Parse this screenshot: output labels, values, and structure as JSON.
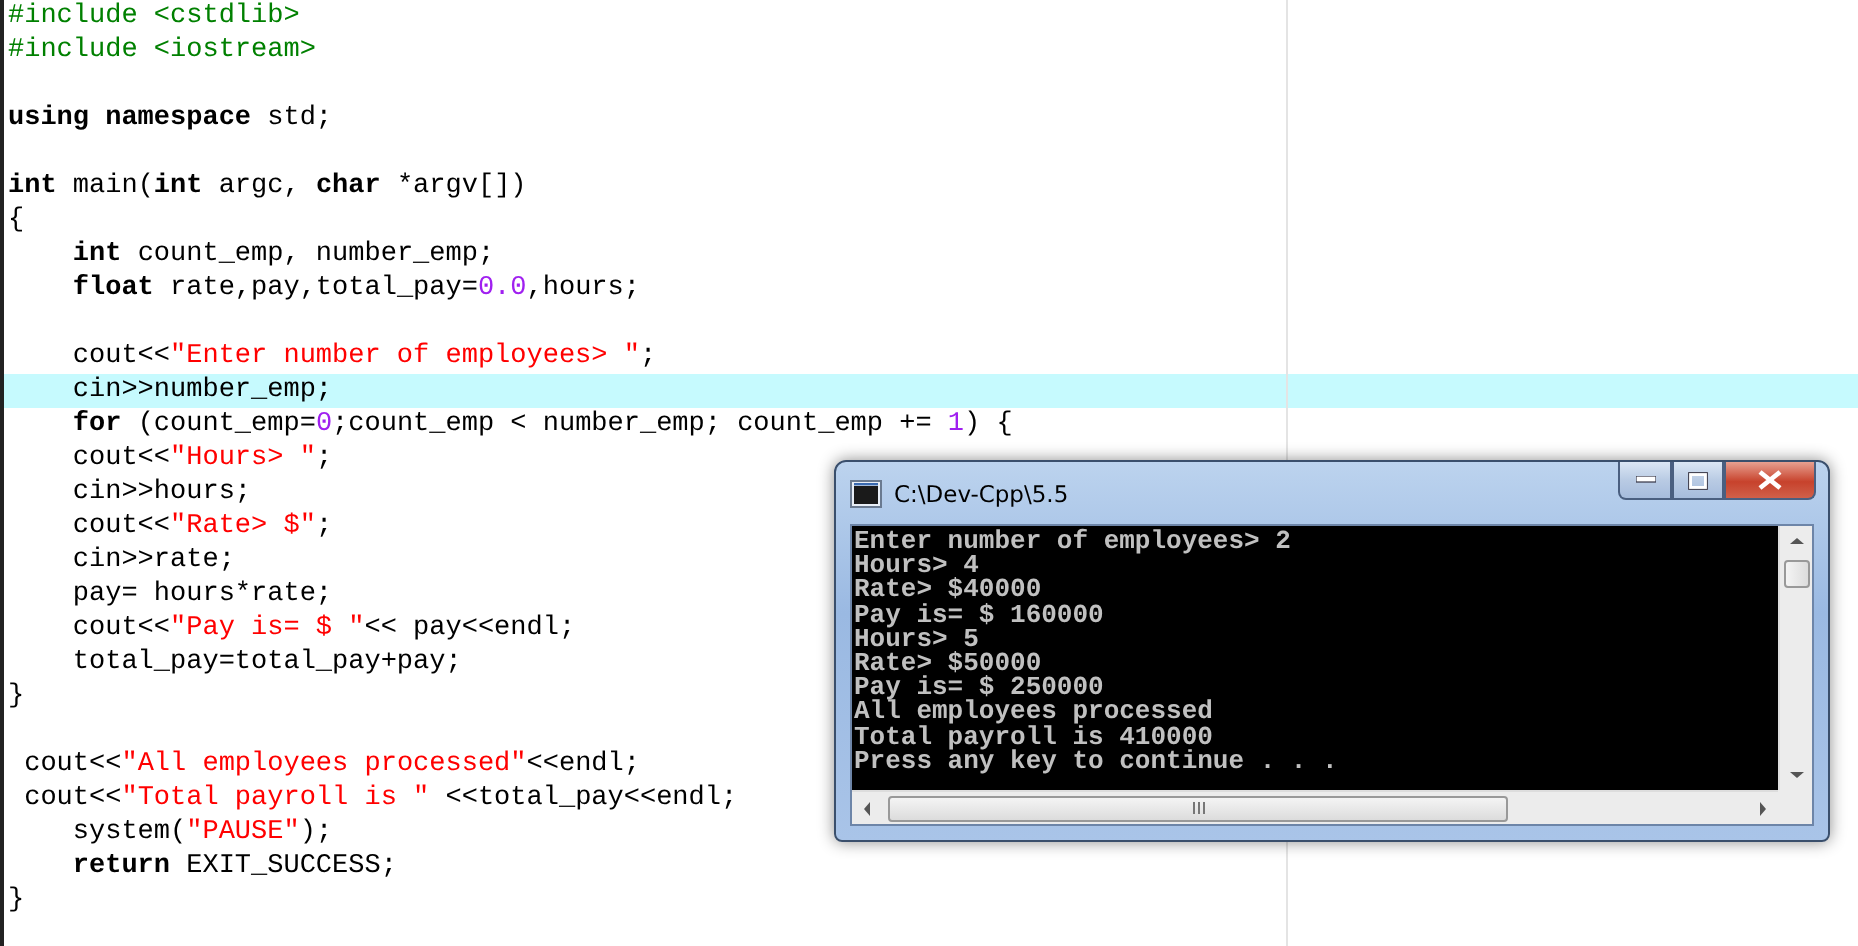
{
  "editor": {
    "lines": [
      {
        "highlighted": false,
        "tokens": [
          {
            "kind": "preproc",
            "text": "#include <cstdlib>"
          }
        ]
      },
      {
        "highlighted": false,
        "tokens": [
          {
            "kind": "preproc",
            "text": "#include <iostream>"
          }
        ]
      },
      {
        "highlighted": false
      },
      {
        "highlighted": false,
        "tokens": [
          {
            "kind": "keyword",
            "text": "using namespace"
          },
          {
            "kind": "plain",
            "text": " std;"
          }
        ]
      },
      {
        "highlighted": false
      },
      {
        "highlighted": false,
        "tokens": [
          {
            "kind": "keyword",
            "text": "int"
          },
          {
            "kind": "plain",
            "text": " main("
          },
          {
            "kind": "keyword",
            "text": "int"
          },
          {
            "kind": "plain",
            "text": " argc, "
          },
          {
            "kind": "keyword",
            "text": "char"
          },
          {
            "kind": "plain",
            "text": " *argv[])"
          }
        ]
      },
      {
        "highlighted": false,
        "tokens": [
          {
            "kind": "plain",
            "text": "{"
          }
        ]
      },
      {
        "highlighted": false,
        "tokens": [
          {
            "kind": "keyword",
            "text": "    int"
          },
          {
            "kind": "plain",
            "text": " count_emp, number_emp;"
          }
        ]
      },
      {
        "highlighted": false,
        "tokens": [
          {
            "kind": "keyword",
            "text": "    float"
          },
          {
            "kind": "plain",
            "text": " rate,pay,total_pay="
          },
          {
            "kind": "number",
            "text": "0.0"
          },
          {
            "kind": "plain",
            "text": ",hours;"
          }
        ]
      },
      {
        "highlighted": false
      },
      {
        "highlighted": false,
        "tokens": [
          {
            "kind": "plain",
            "text": "    cout<<"
          },
          {
            "kind": "string",
            "text": "\"Enter number of employees> \""
          },
          {
            "kind": "plain",
            "text": ";"
          }
        ]
      },
      {
        "highlighted": true,
        "tokens": [
          {
            "kind": "plain",
            "text": "    cin>>number_emp;"
          }
        ]
      },
      {
        "highlighted": false,
        "tokens": [
          {
            "kind": "keyword",
            "text": "    for"
          },
          {
            "kind": "plain",
            "text": " (count_emp="
          },
          {
            "kind": "number",
            "text": "0"
          },
          {
            "kind": "plain",
            "text": ";count_emp < number_emp; count_emp += "
          },
          {
            "kind": "number",
            "text": "1"
          },
          {
            "kind": "plain",
            "text": ") {"
          }
        ]
      },
      {
        "highlighted": false,
        "tokens": [
          {
            "kind": "plain",
            "text": "    cout<<"
          },
          {
            "kind": "string",
            "text": "\"Hours> \""
          },
          {
            "kind": "plain",
            "text": ";"
          }
        ]
      },
      {
        "highlighted": false,
        "tokens": [
          {
            "kind": "plain",
            "text": "    cin>>hours;"
          }
        ]
      },
      {
        "highlighted": false,
        "tokens": [
          {
            "kind": "plain",
            "text": "    cout<<"
          },
          {
            "kind": "string",
            "text": "\"Rate> $\""
          },
          {
            "kind": "plain",
            "text": ";"
          }
        ]
      },
      {
        "highlighted": false,
        "tokens": [
          {
            "kind": "plain",
            "text": "    cin>>rate;"
          }
        ]
      },
      {
        "highlighted": false,
        "tokens": [
          {
            "kind": "plain",
            "text": "    pay= hours*rate;"
          }
        ]
      },
      {
        "highlighted": false,
        "tokens": [
          {
            "kind": "plain",
            "text": "    cout<<"
          },
          {
            "kind": "string",
            "text": "\"Pay is= $ \""
          },
          {
            "kind": "plain",
            "text": "<< pay<<endl;"
          }
        ]
      },
      {
        "highlighted": false,
        "tokens": [
          {
            "kind": "plain",
            "text": "    total_pay=total_pay+pay;"
          }
        ]
      },
      {
        "highlighted": false,
        "tokens": [
          {
            "kind": "plain",
            "text": "}"
          }
        ]
      },
      {
        "highlighted": false
      },
      {
        "highlighted": false,
        "tokens": [
          {
            "kind": "plain",
            "text": " cout<<"
          },
          {
            "kind": "string",
            "text": "\"All employees processed\""
          },
          {
            "kind": "plain",
            "text": "<<endl;"
          }
        ]
      },
      {
        "highlighted": false,
        "tokens": [
          {
            "kind": "plain",
            "text": " cout<<"
          },
          {
            "kind": "string",
            "text": "\"Total payroll is \""
          },
          {
            "kind": "plain",
            "text": " <<total_pay<<endl;"
          }
        ]
      },
      {
        "highlighted": false,
        "tokens": [
          {
            "kind": "plain",
            "text": "    system("
          },
          {
            "kind": "string",
            "text": "\"PAUSE\""
          },
          {
            "kind": "plain",
            "text": ");"
          }
        ]
      },
      {
        "highlighted": false,
        "tokens": [
          {
            "kind": "keyword",
            "text": "    return"
          },
          {
            "kind": "plain",
            "text": " EXIT_SUCCESS;"
          }
        ]
      },
      {
        "highlighted": false,
        "tokens": [
          {
            "kind": "plain",
            "text": "}"
          }
        ]
      }
    ]
  },
  "console": {
    "title": "C:\\Dev-Cpp\\5.5",
    "output": [
      "Enter number of employees> 2",
      "Hours> 4",
      "Rate> $40000",
      "Pay is= $ 160000",
      "Hours> 5",
      "Rate> $50000",
      "Pay is= $ 250000",
      "All employees processed",
      "Total payroll is 410000",
      "Press any key to continue . . ."
    ]
  }
}
